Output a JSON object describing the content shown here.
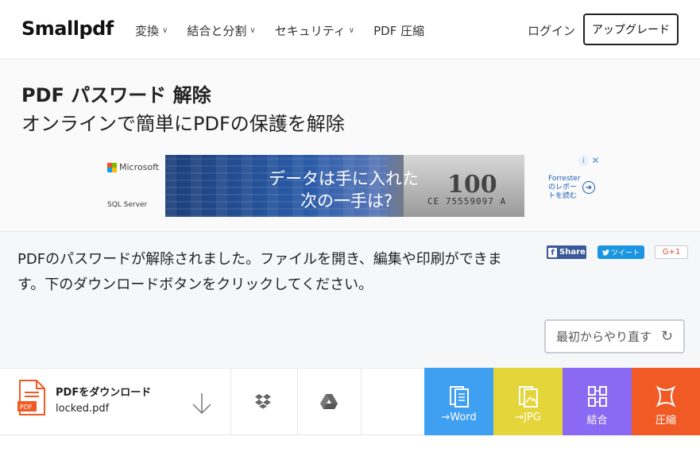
{
  "header": {
    "logo": "Smallpdf",
    "nav": [
      {
        "label": "変換",
        "dropdown": true
      },
      {
        "label": "結合と分割",
        "dropdown": true
      },
      {
        "label": "セキュリティ",
        "dropdown": true
      },
      {
        "label": "PDF 圧縮",
        "dropdown": false
      }
    ],
    "login": "ログイン",
    "upgrade": "アップグレード"
  },
  "hero": {
    "title": "PDF パスワード 解除",
    "subtitle": "オンラインで簡単にPDFの保護を解除"
  },
  "ad": {
    "brand": "Microsoft",
    "product": "SQL Server",
    "line1": "データは手に入れた",
    "line2": "次の一手は?",
    "bill_serial": "CE 75559097 A",
    "bill_value": "100",
    "forrester": "Forrester\nのレポー\nトを読む",
    "info_icon": "info-icon",
    "close_icon": "close-icon"
  },
  "result": {
    "message": "PDFのパスワードが解除されました。ファイルを開き、編集や印刷ができます。下のダウンロードボタンをクリックしてください。",
    "share": {
      "facebook": "Share",
      "twitter": "ツイート",
      "google": "G+1"
    },
    "restart": "最初からやり直す"
  },
  "download": {
    "title": "PDFをダウンロード",
    "filename": "locked.pdf",
    "file_badge": "PDF"
  },
  "tiles": [
    {
      "label": "→Word",
      "color": "#3f9ff0"
    },
    {
      "label": "→JPG",
      "color": "#e4d63a"
    },
    {
      "label": "結合",
      "color": "#8a6af2"
    },
    {
      "label": "圧縮",
      "color": "#f15a24"
    }
  ],
  "colors": {
    "accent_pdf": "#f15a24",
    "facebook": "#3b5998",
    "twitter": "#1b95e0"
  }
}
